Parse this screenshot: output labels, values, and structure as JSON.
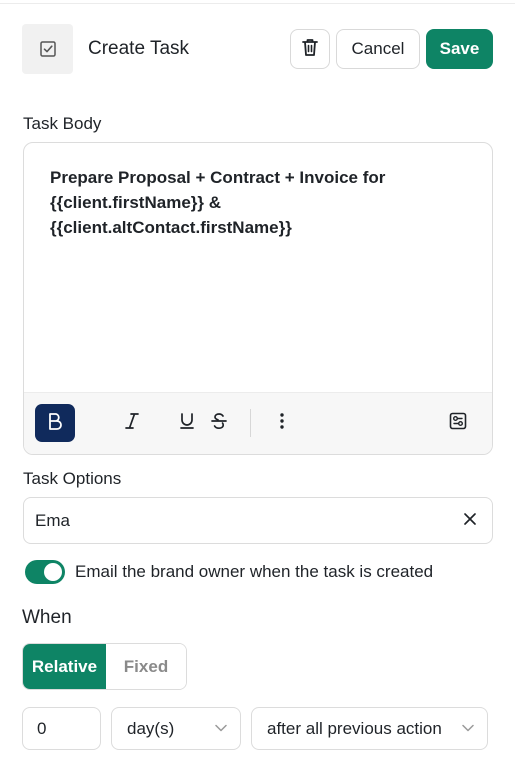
{
  "header": {
    "title": "Create Task",
    "cancel_label": "Cancel",
    "save_label": "Save",
    "icon": "checkbox-task-icon",
    "delete_icon": "trash-icon"
  },
  "task_body": {
    "label": "Task Body",
    "lines": [
      "Prepare Proposal + Contract + Invoice for",
      "{{client.firstName}} &",
      "{{client.altContact.firstName}}"
    ],
    "toolbar": [
      "bold-icon",
      "italic-icon",
      "underline-icon",
      "strikethrough-icon",
      "more-vertical-icon",
      "variables-icon"
    ]
  },
  "task_options": {
    "label": "Task Options",
    "input_value": "Ema",
    "clear_icon": "close-icon"
  },
  "notify": {
    "enabled": true,
    "label": "Email the brand owner when the task is created"
  },
  "when": {
    "label": "When",
    "modes": [
      "Relative",
      "Fixed"
    ],
    "selected_mode": "Relative",
    "amount": "0",
    "unit": "day(s)",
    "anchor": "after all previous action"
  },
  "colors": {
    "accent": "#0e8465",
    "bold_active": "#102a5c"
  }
}
